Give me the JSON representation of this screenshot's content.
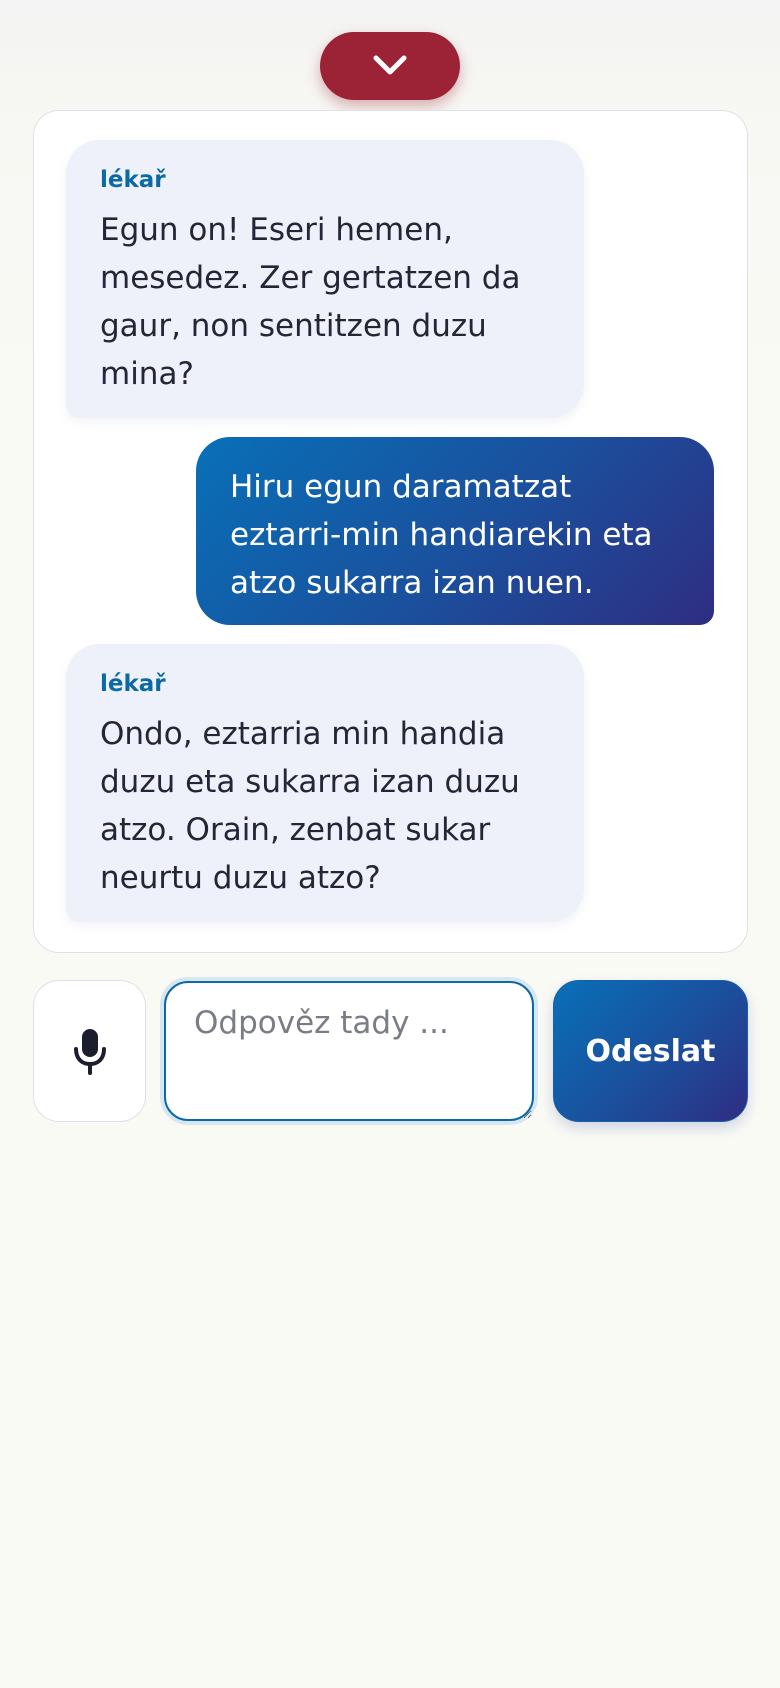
{
  "header": {
    "collapse_icon": "chevron-down-icon",
    "collapse_color": "#9b2335"
  },
  "chat": {
    "messages": [
      {
        "role": "doctor",
        "speaker": "lékař",
        "text": "Egun on! Eseri hemen, mesedez. Zer gertatzen da gaur, non sentitzen duzu mina?"
      },
      {
        "role": "patient",
        "speaker": "",
        "text": "Hiru egun daramatzat eztarri-min handiarekin eta atzo sukarra izan nuen."
      },
      {
        "role": "doctor",
        "speaker": "lékař",
        "text": "Ondo, eztarria min handia duzu eta sukarra izan duzu atzo. Orain, zenbat sukar neurtu duzu atzo?"
      }
    ]
  },
  "composer": {
    "mic_icon": "microphone-icon",
    "placeholder": "Odpověz tady ...",
    "value": "",
    "send_label": "Odeslat"
  },
  "colors": {
    "accent": "#0b6aa6",
    "doctor_bubble": "#eef0fa",
    "patient_bubble_start": "#0870b8",
    "patient_bubble_end": "#2f2d82"
  }
}
